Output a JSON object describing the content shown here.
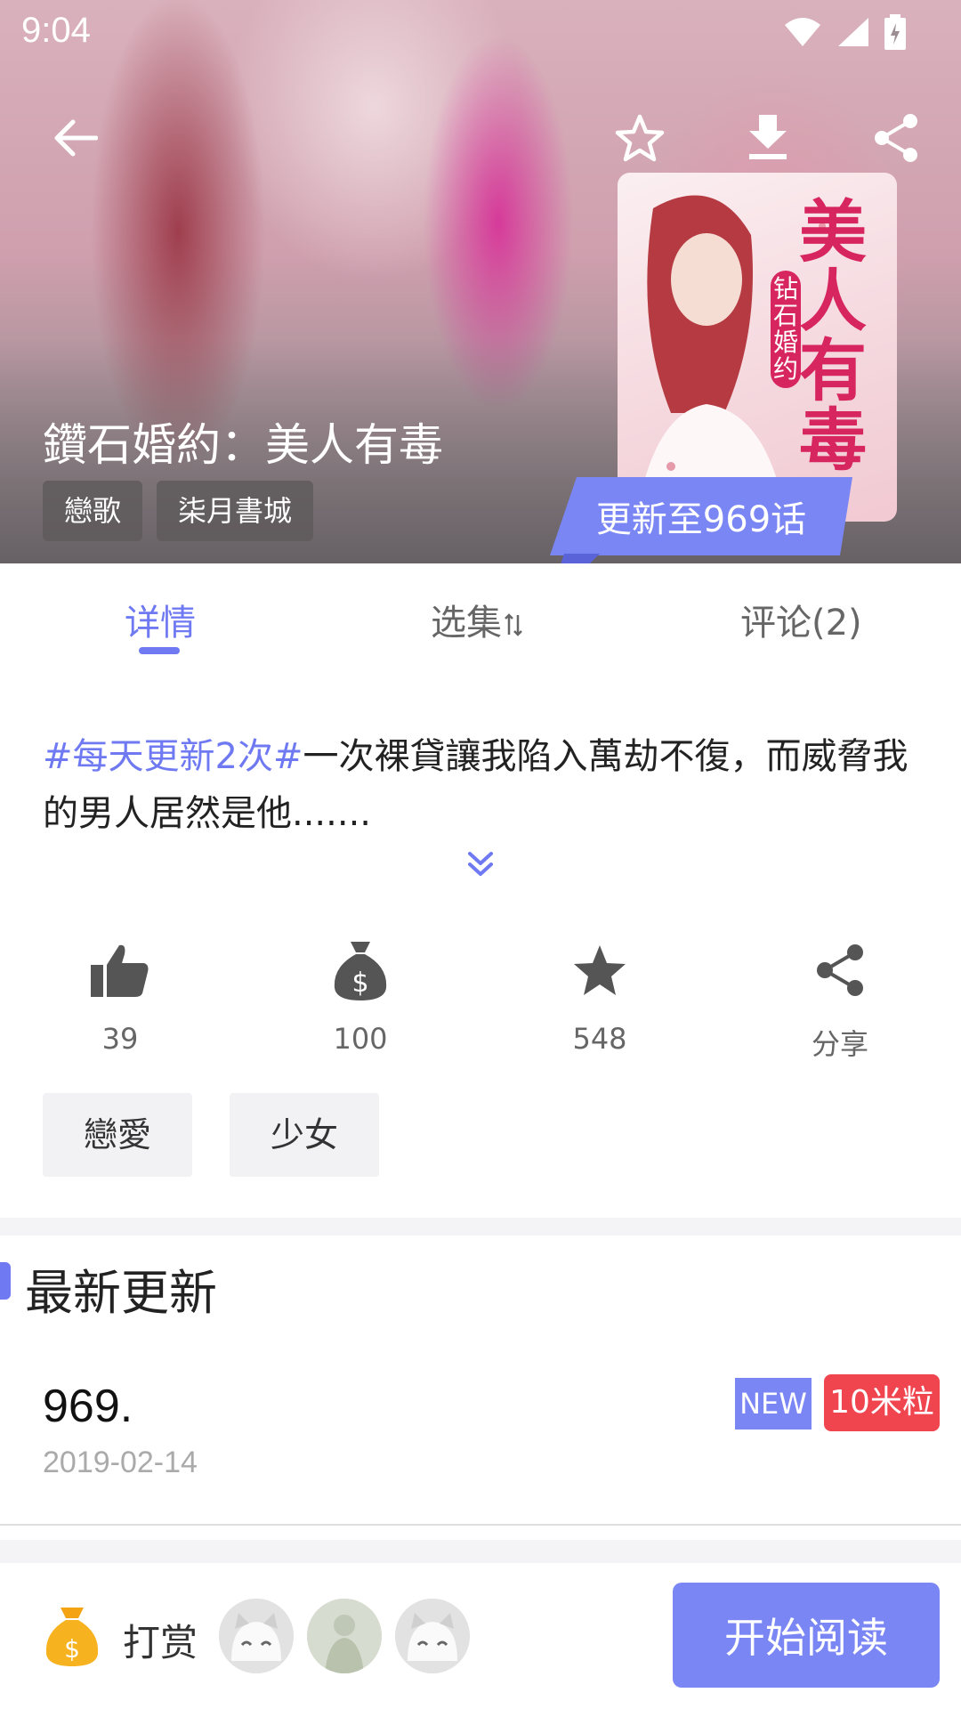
{
  "status_bar": {
    "time": "9:04"
  },
  "book": {
    "title": "鑽石婚約：美人有毒",
    "tags": [
      "戀歌",
      "柒月書城"
    ],
    "cover_title": "美人有毒",
    "cover_subtitle": "钻石婚约"
  },
  "update_banner": "更新至969话",
  "tabs": [
    {
      "label": "详情",
      "active": true
    },
    {
      "label": "选集",
      "active": false
    },
    {
      "label": "评论(2)",
      "active": false
    }
  ],
  "description": {
    "hashtag": "#每天更新2次#",
    "text": "一次裸貸讓我陷入萬劫不復，而威脅我的男人居然是他......."
  },
  "stats": [
    {
      "icon": "thumbs-up-icon",
      "value": "39"
    },
    {
      "icon": "money-bag-icon",
      "value": "100"
    },
    {
      "icon": "star-icon",
      "value": "548"
    },
    {
      "icon": "share-icon",
      "value": "分享"
    }
  ],
  "categories": [
    "戀愛",
    "少女"
  ],
  "latest_update": {
    "section_title": "最新更新",
    "chapter": "969.",
    "date": "2019-02-14",
    "badge_new": "NEW",
    "badge_price": "10米粒"
  },
  "bottom_bar": {
    "tip_label": "打赏",
    "read_button": "开始阅读"
  },
  "colors": {
    "accent": "#6e79f2",
    "banner": "#7b86f5",
    "price_badge": "#f0454f"
  }
}
